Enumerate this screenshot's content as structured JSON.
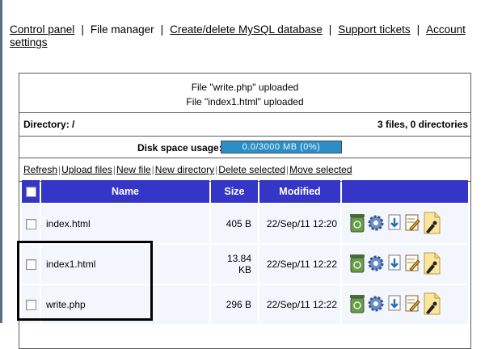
{
  "nav": {
    "items": [
      "Control panel",
      "File manager",
      "Create/delete MySQL database",
      "Support tickets",
      "Account settings"
    ],
    "separator": "|"
  },
  "status": {
    "line1": "File \"write.php\" uploaded",
    "line2": "File \"index1.html\" uploaded"
  },
  "directory": {
    "label": "Directory: /",
    "summary": "3 files, 0 directories"
  },
  "disk": {
    "label": "Disk space usage:",
    "value": "0.0/3000 MB (0%)",
    "used_fraction": 0.0
  },
  "actions": [
    "Refresh",
    "Upload files",
    "New file",
    "New directory",
    "Delete selected",
    "Move selected"
  ],
  "table": {
    "columns": [
      "Name",
      "Size",
      "Modified"
    ],
    "rows": [
      {
        "name": "index.html",
        "size": "405 B",
        "modified": "22/Sep/11 12:20"
      },
      {
        "name": "index1.html",
        "size": "13.84 KB",
        "modified": "22/Sep/11 12:22"
      },
      {
        "name": "write.php",
        "size": "296 B",
        "modified": "22/Sep/11 12:22"
      }
    ]
  },
  "icons": {
    "row_ops": [
      "trash-icon",
      "gear-icon",
      "download-icon",
      "edit-icon",
      "rename-icon"
    ]
  },
  "colors": {
    "header_bg": "#3535c8",
    "disk_bar": "#2a8fc8",
    "row_bg": "#f4f6fd"
  }
}
